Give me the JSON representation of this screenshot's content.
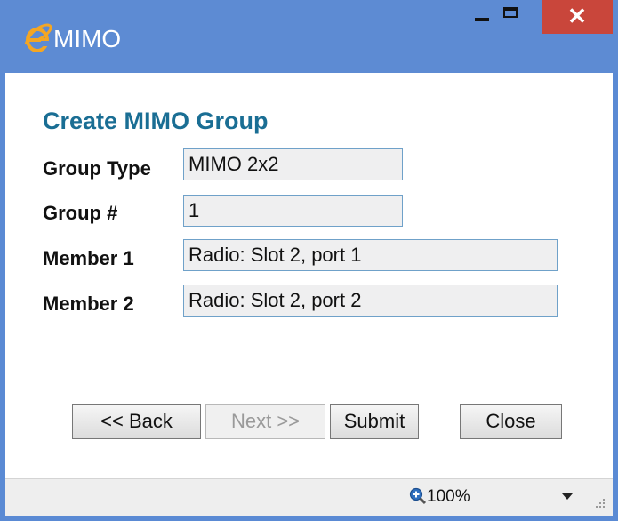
{
  "window": {
    "title": "MIMO",
    "close_glyph": "✕",
    "icon": "internet-explorer-icon"
  },
  "form": {
    "heading": "Create MIMO Group",
    "fields": [
      {
        "label": "Group Type",
        "value": "MIMO 2x2"
      },
      {
        "label": "Group #",
        "value": "1"
      },
      {
        "label": "Member 1",
        "value": "Radio: Slot 2, port 1"
      },
      {
        "label": "Member 2",
        "value": "Radio: Slot 2, port 2"
      }
    ]
  },
  "buttons": {
    "back": "<< Back",
    "next": "Next >>",
    "submit": "Submit",
    "close": "Close"
  },
  "statusbar": {
    "zoom": "100%",
    "zoom_icon": "zoom-in-icon"
  },
  "colors": {
    "titlebar": "#5d8bd3",
    "close_button": "#c9463b",
    "heading": "#1a6e94",
    "field_border": "#6fa1c9",
    "field_background": "#efeff0"
  }
}
